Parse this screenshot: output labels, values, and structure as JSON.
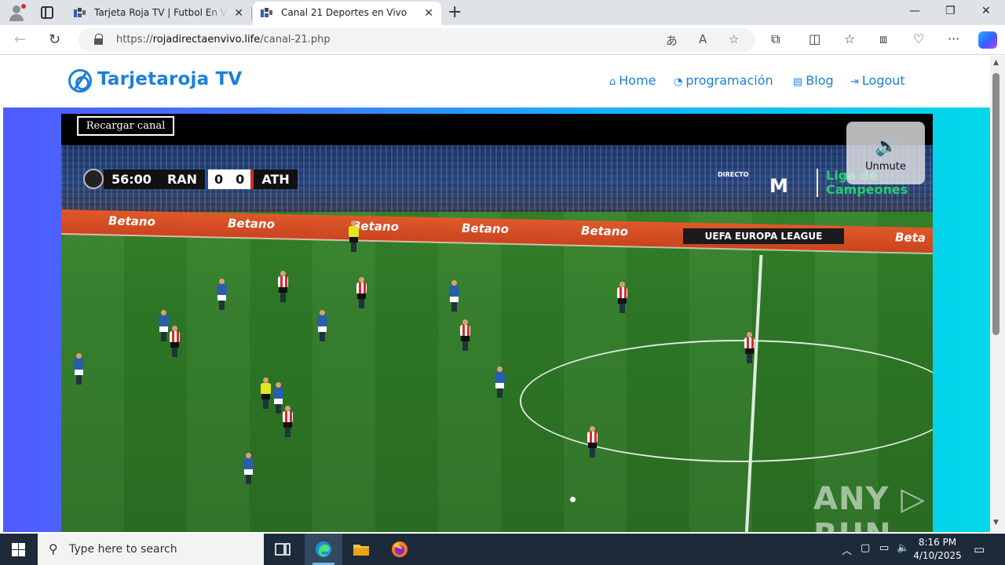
{
  "browser": {
    "tabs": [
      {
        "title": "Tarjeta Roja TV | Futbol En Vivo - Gratis",
        "active": false
      },
      {
        "title": "Canal 21 Deportes en Vivo",
        "active": true
      }
    ],
    "url_prefix": "https://",
    "url_host": "rojadirectaenvivo.life",
    "url_path": "/canal-21.php"
  },
  "site": {
    "logo_text": "Tarjetaroja TV",
    "nav": [
      {
        "label": "Home",
        "icon": "home-icon"
      },
      {
        "label": "programación",
        "icon": "tachometer-icon"
      },
      {
        "label": "Blog",
        "icon": "newspaper-icon"
      },
      {
        "label": "Logout",
        "icon": "sign-out-icon"
      }
    ],
    "accent_color": "#1d7fd9"
  },
  "player": {
    "reload_label": "Recargar canal",
    "unmute_label": "Unmute",
    "scorebug": {
      "time": "56:00",
      "home": "RAN",
      "home_score": "0",
      "away_score": "0",
      "away": "ATH"
    },
    "broadcaster_tag": "DIRECTO",
    "broadcaster_logo": "M",
    "competition_line1": "Liga de",
    "competition_line2": "Campeones",
    "ad_boards": [
      "Betano",
      "Betano",
      "Betano",
      "Betano",
      "Betano",
      "Beta"
    ],
    "league_board": "UEFA EUROPA LEAGUE",
    "watermark": "ANY ▷ RUN"
  },
  "taskbar": {
    "search_placeholder": "Type here to search",
    "time": "8:16 PM",
    "date": "4/10/2025"
  }
}
